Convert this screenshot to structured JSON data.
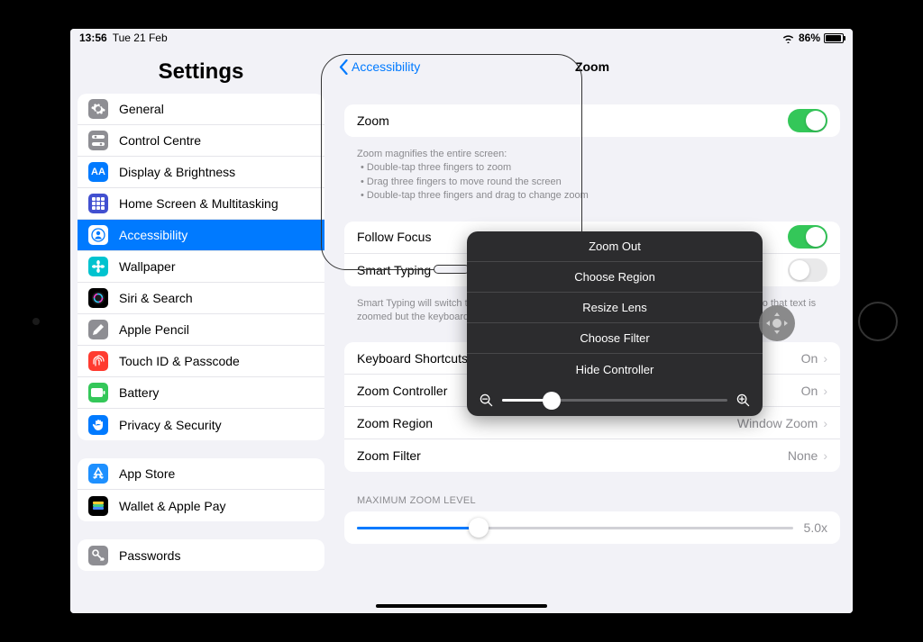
{
  "status": {
    "time": "13:56",
    "date": "Tue 21 Feb",
    "battery_pct": "86%"
  },
  "sidebar": {
    "title": "Settings",
    "groups": [
      {
        "items": [
          {
            "label": "General",
            "icon": "gear",
            "bg": "#8e8e93"
          },
          {
            "label": "Control Centre",
            "icon": "switches",
            "bg": "#8e8e93"
          },
          {
            "label": "Display & Brightness",
            "icon": "AA",
            "bg": "#007aff"
          },
          {
            "label": "Home Screen & Multitasking",
            "icon": "grid",
            "bg": "#4250d0"
          },
          {
            "label": "Accessibility",
            "icon": "person",
            "bg": "#007aff",
            "selected": true
          },
          {
            "label": "Wallpaper",
            "icon": "flower",
            "bg": "#00c3cf"
          },
          {
            "label": "Siri & Search",
            "icon": "siri",
            "bg": "#000"
          },
          {
            "label": "Apple Pencil",
            "icon": "pencil",
            "bg": "#8e8e93"
          },
          {
            "label": "Touch ID & Passcode",
            "icon": "fingerprint",
            "bg": "#ff3b30"
          },
          {
            "label": "Battery",
            "icon": "battery",
            "bg": "#34c759"
          },
          {
            "label": "Privacy & Security",
            "icon": "hand",
            "bg": "#007aff"
          }
        ]
      },
      {
        "items": [
          {
            "label": "App Store",
            "icon": "appstore",
            "bg": "#1e90ff"
          },
          {
            "label": "Wallet & Apple Pay",
            "icon": "wallet",
            "bg": "#000"
          }
        ]
      },
      {
        "items": [
          {
            "label": "Passwords",
            "icon": "key",
            "bg": "#8e8e93"
          }
        ]
      }
    ]
  },
  "detail": {
    "back_label": "Accessibility",
    "title": "Zoom",
    "zoom": {
      "label": "Zoom",
      "on": true
    },
    "help_title": "Zoom magnifies the entire screen:",
    "help_bullets": [
      "Double-tap three fingers to zoom",
      "Drag three fingers to move round the screen",
      "Double-tap three fingers and drag to change zoom"
    ],
    "follow_focus": {
      "label": "Follow Focus",
      "on": true
    },
    "smart_typing": {
      "label": "Smart Typing",
      "on": false,
      "footer": "Smart Typing will switch to Window Zoom when a keyboard appears and move the window so that text is zoomed but the keyboard is not."
    },
    "keyboard_shortcuts": {
      "label": "Keyboard Shortcuts",
      "value": "On"
    },
    "zoom_controller": {
      "label": "Zoom Controller",
      "value": "On"
    },
    "zoom_region": {
      "label": "Zoom Region",
      "value": "Window Zoom"
    },
    "zoom_filter": {
      "label": "Zoom Filter",
      "value": "None"
    },
    "max_zoom_header": "MAXIMUM ZOOM LEVEL",
    "max_zoom_value": "5.0x"
  },
  "controller_menu": {
    "items": [
      "Zoom Out",
      "Choose Region",
      "Resize Lens",
      "Choose Filter",
      "Hide Controller"
    ]
  }
}
